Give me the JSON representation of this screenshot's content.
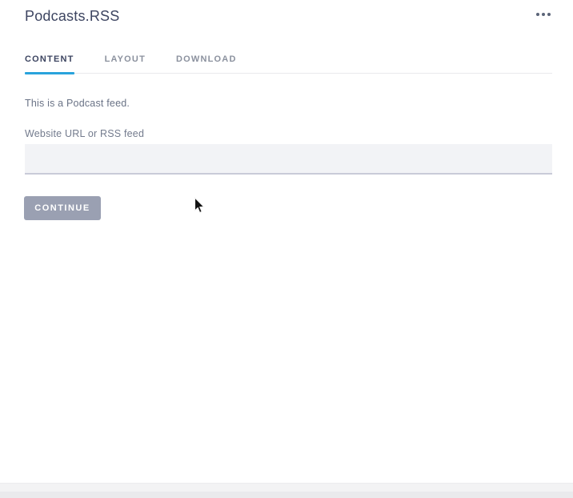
{
  "header": {
    "title": "Podcasts.RSS",
    "menu_icon": "ellipsis-icon"
  },
  "tabs": [
    {
      "label": "CONTENT",
      "active": true
    },
    {
      "label": "LAYOUT",
      "active": false
    },
    {
      "label": "DOWNLOAD",
      "active": false
    }
  ],
  "content": {
    "description": "This is a Podcast feed.",
    "field_label": "Website URL or RSS feed",
    "field_value": "",
    "continue_label": "CONTINUE"
  },
  "colors": {
    "accent_blue": "#29a3dc",
    "title_text": "#3d4561",
    "muted_text": "#6a7386",
    "button_bg": "#9aa0b2",
    "input_bg": "#f2f3f6",
    "input_border": "#c9cbd8",
    "footer_bar": "#eaeaec"
  }
}
